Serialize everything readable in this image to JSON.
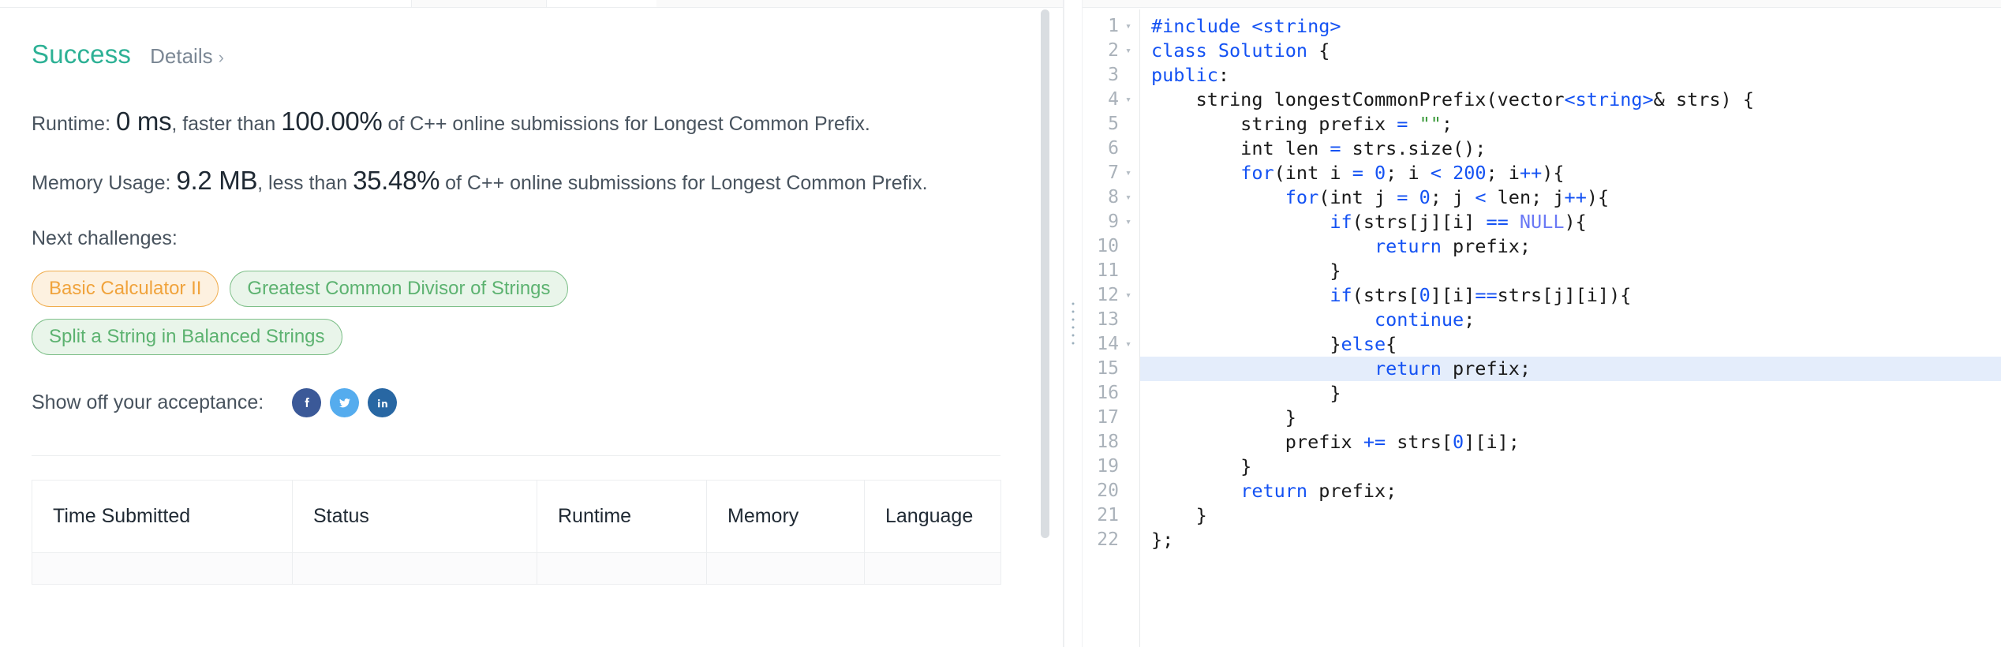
{
  "result": {
    "status": "Success",
    "details_label": "Details",
    "details_chevron": "›",
    "runtime": {
      "prefix": "Runtime:",
      "value": "0 ms",
      "mid": ", faster than",
      "percent": "100.00%",
      "suffix": "of C++ online submissions for Longest Common Prefix."
    },
    "memory": {
      "prefix": "Memory Usage:",
      "value": "9.2 MB",
      "mid": ", less than",
      "percent": "35.48%",
      "suffix": "of C++ online submissions for Longest Common Prefix."
    },
    "next_challenges_label": "Next challenges:",
    "next_challenges": [
      {
        "label": "Basic Calculator II",
        "difficulty": "medium"
      },
      {
        "label": "Greatest Common Divisor of Strings",
        "difficulty": "easy"
      },
      {
        "label": "Split a String in Balanced Strings",
        "difficulty": "easy"
      }
    ],
    "share_label": "Show off your acceptance:",
    "social": [
      {
        "name": "facebook-icon",
        "color": "#3b5998"
      },
      {
        "name": "twitter-icon",
        "color": "#55acee"
      },
      {
        "name": "linkedin-icon",
        "color": "#2867a3"
      }
    ]
  },
  "submissions_table": {
    "columns": [
      "Time Submitted",
      "Status",
      "Runtime",
      "Memory",
      "Language"
    ]
  },
  "editor": {
    "highlighted_line": 15,
    "lines": [
      {
        "n": 1,
        "fold": true,
        "tokens": [
          {
            "t": "#include ",
            "c": "pre"
          },
          {
            "t": "<string>",
            "c": "pre"
          }
        ]
      },
      {
        "n": 2,
        "fold": true,
        "tokens": [
          {
            "t": "class ",
            "c": "kw"
          },
          {
            "t": "Solution",
            "c": "kw"
          },
          {
            "t": " {",
            "c": "pl"
          }
        ]
      },
      {
        "n": 3,
        "fold": false,
        "tokens": [
          {
            "t": "public",
            "c": "kw"
          },
          {
            "t": ":",
            "c": "pl"
          }
        ]
      },
      {
        "n": 4,
        "fold": true,
        "tokens": [
          {
            "t": "    string longestCommonPrefix(vector",
            "c": "pl"
          },
          {
            "t": "<string>",
            "c": "kw"
          },
          {
            "t": "& strs) {",
            "c": "pl"
          }
        ]
      },
      {
        "n": 5,
        "fold": false,
        "tokens": [
          {
            "t": "        string prefix ",
            "c": "pl"
          },
          {
            "t": "=",
            "c": "op"
          },
          {
            "t": " ",
            "c": "pl"
          },
          {
            "t": "\"\"",
            "c": "str"
          },
          {
            "t": ";",
            "c": "pl"
          }
        ]
      },
      {
        "n": 6,
        "fold": false,
        "tokens": [
          {
            "t": "        int len ",
            "c": "pl"
          },
          {
            "t": "=",
            "c": "op"
          },
          {
            "t": " strs.size();",
            "c": "pl"
          }
        ]
      },
      {
        "n": 7,
        "fold": true,
        "tokens": [
          {
            "t": "        ",
            "c": "pl"
          },
          {
            "t": "for",
            "c": "kw"
          },
          {
            "t": "(int i ",
            "c": "pl"
          },
          {
            "t": "=",
            "c": "op"
          },
          {
            "t": " ",
            "c": "pl"
          },
          {
            "t": "0",
            "c": "num"
          },
          {
            "t": "; i ",
            "c": "pl"
          },
          {
            "t": "<",
            "c": "op"
          },
          {
            "t": " ",
            "c": "pl"
          },
          {
            "t": "200",
            "c": "num"
          },
          {
            "t": "; i",
            "c": "pl"
          },
          {
            "t": "++",
            "c": "op"
          },
          {
            "t": "){",
            "c": "pl"
          }
        ]
      },
      {
        "n": 8,
        "fold": true,
        "tokens": [
          {
            "t": "            ",
            "c": "pl"
          },
          {
            "t": "for",
            "c": "kw"
          },
          {
            "t": "(int j ",
            "c": "pl"
          },
          {
            "t": "=",
            "c": "op"
          },
          {
            "t": " ",
            "c": "pl"
          },
          {
            "t": "0",
            "c": "num"
          },
          {
            "t": "; j ",
            "c": "pl"
          },
          {
            "t": "<",
            "c": "op"
          },
          {
            "t": " len; j",
            "c": "pl"
          },
          {
            "t": "++",
            "c": "op"
          },
          {
            "t": "){",
            "c": "pl"
          }
        ]
      },
      {
        "n": 9,
        "fold": true,
        "tokens": [
          {
            "t": "                ",
            "c": "pl"
          },
          {
            "t": "if",
            "c": "kw"
          },
          {
            "t": "(strs[j][i] ",
            "c": "pl"
          },
          {
            "t": "==",
            "c": "op"
          },
          {
            "t": " ",
            "c": "pl"
          },
          {
            "t": "NULL",
            "c": "const"
          },
          {
            "t": "){",
            "c": "pl"
          }
        ]
      },
      {
        "n": 10,
        "fold": false,
        "tokens": [
          {
            "t": "                    ",
            "c": "pl"
          },
          {
            "t": "return",
            "c": "kw"
          },
          {
            "t": " prefix;",
            "c": "pl"
          }
        ]
      },
      {
        "n": 11,
        "fold": false,
        "tokens": [
          {
            "t": "                }",
            "c": "pl"
          }
        ]
      },
      {
        "n": 12,
        "fold": true,
        "tokens": [
          {
            "t": "                ",
            "c": "pl"
          },
          {
            "t": "if",
            "c": "kw"
          },
          {
            "t": "(strs[",
            "c": "pl"
          },
          {
            "t": "0",
            "c": "num"
          },
          {
            "t": "][i]",
            "c": "pl"
          },
          {
            "t": "==",
            "c": "op"
          },
          {
            "t": "strs[j][i]){",
            "c": "pl"
          }
        ]
      },
      {
        "n": 13,
        "fold": false,
        "tokens": [
          {
            "t": "                    ",
            "c": "pl"
          },
          {
            "t": "continue",
            "c": "kw"
          },
          {
            "t": ";",
            "c": "pl"
          }
        ]
      },
      {
        "n": 14,
        "fold": true,
        "tokens": [
          {
            "t": "                }",
            "c": "pl"
          },
          {
            "t": "else",
            "c": "kw"
          },
          {
            "t": "{",
            "c": "pl"
          }
        ]
      },
      {
        "n": 15,
        "fold": false,
        "tokens": [
          {
            "t": "                    ",
            "c": "pl"
          },
          {
            "t": "return",
            "c": "kw"
          },
          {
            "t": " prefix;",
            "c": "pl"
          }
        ]
      },
      {
        "n": 16,
        "fold": false,
        "tokens": [
          {
            "t": "                }",
            "c": "pl"
          }
        ]
      },
      {
        "n": 17,
        "fold": false,
        "tokens": [
          {
            "t": "            }",
            "c": "pl"
          }
        ]
      },
      {
        "n": 18,
        "fold": false,
        "tokens": [
          {
            "t": "            prefix ",
            "c": "pl"
          },
          {
            "t": "+=",
            "c": "op"
          },
          {
            "t": " strs[",
            "c": "pl"
          },
          {
            "t": "0",
            "c": "num"
          },
          {
            "t": "][i];",
            "c": "pl"
          }
        ]
      },
      {
        "n": 19,
        "fold": false,
        "tokens": [
          {
            "t": "        }",
            "c": "pl"
          }
        ]
      },
      {
        "n": 20,
        "fold": false,
        "tokens": [
          {
            "t": "        ",
            "c": "pl"
          },
          {
            "t": "return",
            "c": "kw"
          },
          {
            "t": " prefix;",
            "c": "pl"
          }
        ]
      },
      {
        "n": 21,
        "fold": false,
        "tokens": [
          {
            "t": "    }",
            "c": "pl"
          }
        ]
      },
      {
        "n": 22,
        "fold": false,
        "tokens": [
          {
            "t": "};",
            "c": "pl"
          }
        ]
      }
    ]
  },
  "colors": {
    "success": "#2db195",
    "medium_pill": "#f0a33c",
    "easy_pill": "#5cb270",
    "highlight_line": "#e4edfb",
    "keyword": "#1452f3",
    "string": "#3a9a3a"
  }
}
